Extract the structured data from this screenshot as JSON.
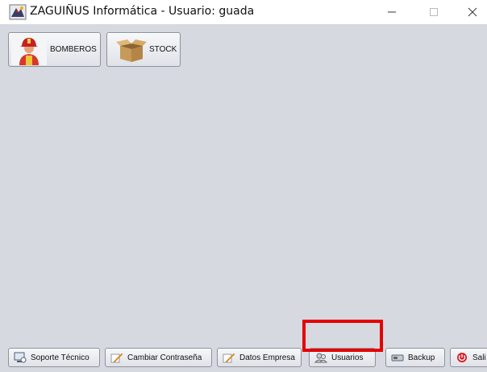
{
  "window": {
    "title": "ZAGUIÑUS Informática - Usuario: guada",
    "icons": {
      "app": "app-logo-icon",
      "minimize": "minimize-icon",
      "maximize": "maximize-icon",
      "close": "close-icon"
    }
  },
  "modules": [
    {
      "label": "BOMBEROS",
      "icon": "firefighter-icon"
    },
    {
      "label": "STOCK",
      "icon": "cardboard-box-icon"
    }
  ],
  "bottom_bar": [
    {
      "label": "Soporte Técnico",
      "icon": "support-icon"
    },
    {
      "label": "Cambiar Contraseña",
      "icon": "pencil-icon"
    },
    {
      "label": "Datos Empresa",
      "icon": "pencil-icon"
    },
    {
      "label": "Usuarios",
      "icon": "users-icon",
      "highlighted": true
    },
    {
      "label": "Backup",
      "icon": "drive-icon"
    },
    {
      "label": "Sali",
      "icon": "power-icon"
    }
  ],
  "colors": {
    "background": "#d6d9e0",
    "highlight": "#e60000",
    "titlebar": "#ffffff"
  }
}
